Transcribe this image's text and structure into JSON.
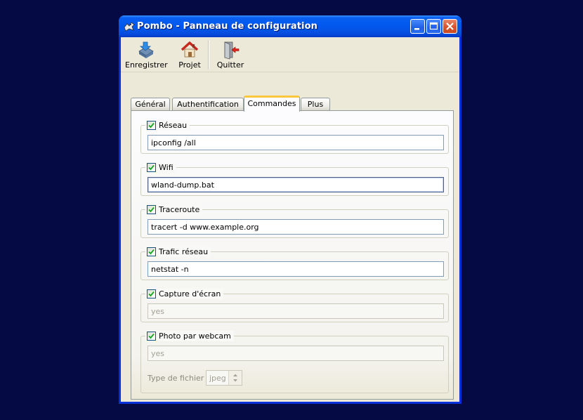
{
  "window": {
    "title": "Pombo - Panneau de configuration"
  },
  "toolbar": {
    "save_label": "Enregistrer",
    "project_label": "Projet",
    "quit_label": "Quitter"
  },
  "tabs": [
    {
      "label": "Général"
    },
    {
      "label": "Authentification"
    },
    {
      "label": "Commandes",
      "active": true
    },
    {
      "label": "Plus"
    }
  ],
  "groups": {
    "reseau": {
      "label": "Réseau",
      "checked": true,
      "value": "ipconfig /all"
    },
    "wifi": {
      "label": "Wifi",
      "checked": true,
      "value": "wland-dump.bat"
    },
    "trace": {
      "label": "Traceroute",
      "checked": true,
      "value": "tracert -d www.example.org"
    },
    "trafic": {
      "label": "Trafic réseau",
      "checked": true,
      "value": "netstat -n"
    },
    "capture": {
      "label": "Capture d'écran",
      "checked": true,
      "value": "yes"
    },
    "webcam": {
      "label": "Photo par webcam",
      "checked": true,
      "value": "yes",
      "file_type_label": "Type de fichier :",
      "file_type_value": "jpeg"
    }
  },
  "colors": {
    "desktop": "#050a45",
    "titlebar": "#0058ee",
    "window_bg": "#ece9d8",
    "tab_highlight": "#ffc83c"
  }
}
